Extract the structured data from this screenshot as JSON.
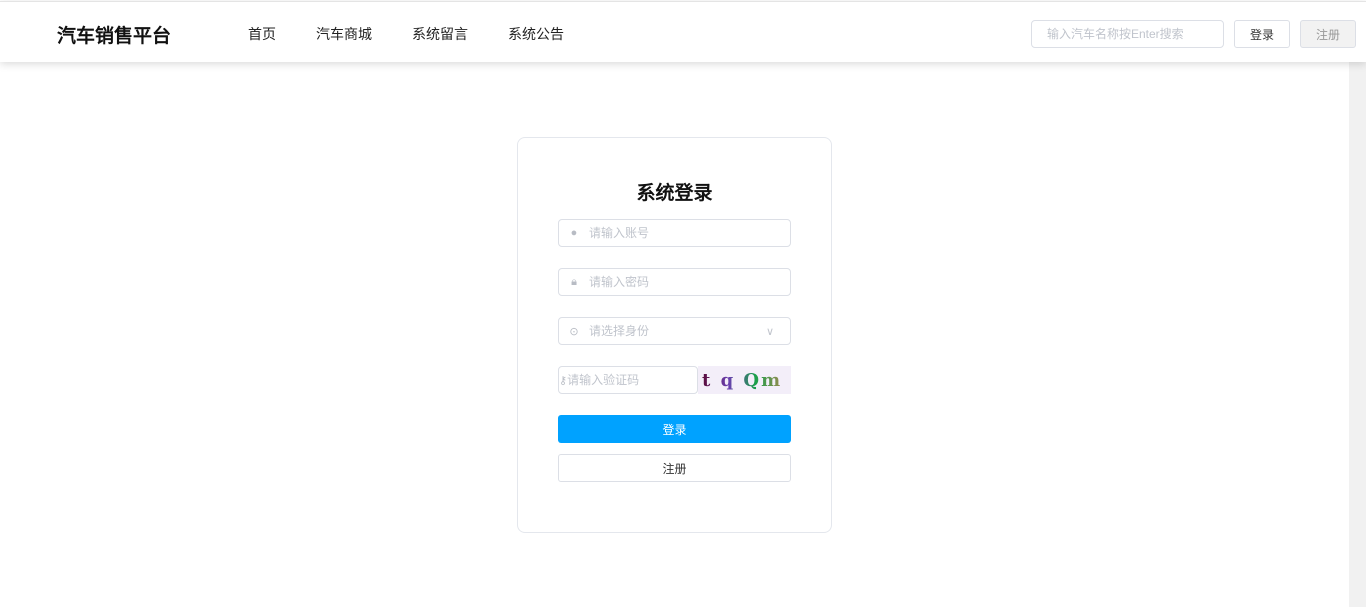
{
  "header": {
    "logo": "汽车销售平台",
    "nav": [
      "首页",
      "汽车商城",
      "系统留言",
      "系统公告"
    ],
    "search_placeholder": "输入汽车名称按Enter搜索",
    "login": "登录",
    "register": "注册"
  },
  "form": {
    "title": "系统登录",
    "account_placeholder": "请输入账号",
    "password_placeholder": "请输入密码",
    "role_placeholder": "请选择身份",
    "captcha_placeholder": "请输入验证码",
    "captcha": "t q Qm",
    "login": "登录",
    "register": "注册"
  }
}
